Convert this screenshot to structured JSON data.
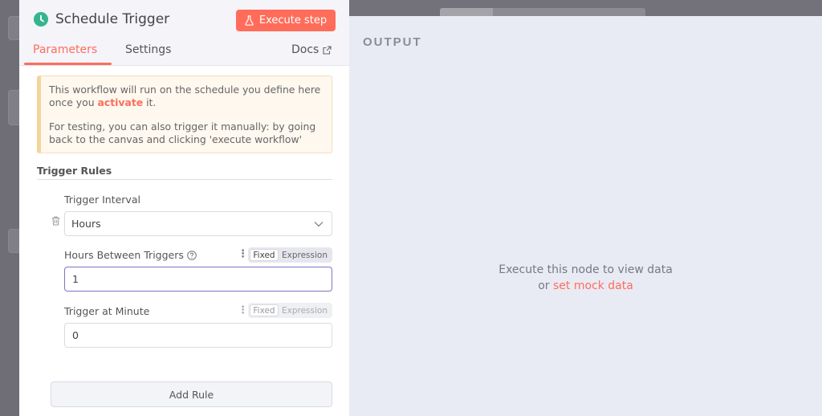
{
  "node": {
    "title": "Schedule Trigger",
    "execute_label": "Execute step",
    "accent": "#ff6d5a",
    "icon": "clock-icon"
  },
  "tabs": {
    "parameters": "Parameters",
    "settings": "Settings",
    "docs": "Docs"
  },
  "notice": {
    "line1_before": "This workflow will run on the schedule you define here once you ",
    "line1_link": "activate",
    "line1_after": " it.",
    "line2": "For testing, you can also trigger it manually: by going back to the canvas and clicking 'execute workflow'"
  },
  "trigger_rules": {
    "title": "Trigger Rules",
    "interval_label": "Trigger Interval",
    "interval_value": "Hours",
    "hours_label": "Hours Between Triggers",
    "hours_value": "1",
    "minute_label": "Trigger at Minute",
    "minute_value": "0",
    "toggle_fixed": "Fixed",
    "toggle_expression": "Expression",
    "add_rule": "Add Rule"
  },
  "output": {
    "title": "OUTPUT",
    "empty_line1": "Execute this node to view data",
    "empty_or": "or ",
    "empty_link": "set mock data"
  }
}
